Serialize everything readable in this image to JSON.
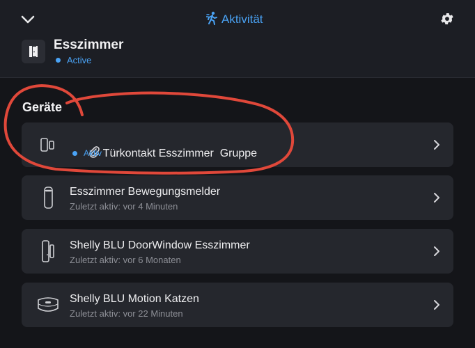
{
  "header": {
    "back_icon": "chevron-down-icon",
    "activity_label": "Aktivität",
    "activity_icon": "walking-person-icon",
    "settings_icon": "gear-icon",
    "room": {
      "name": "Esszimmer",
      "status": "Active",
      "icon": "door-icon"
    }
  },
  "devices": {
    "title": "Geräte",
    "items": [
      {
        "title": "Türkontakt Esszimmer  Gruppe",
        "subtitle": "Aktiv",
        "icon": "door-contact-icon",
        "linked_icon": "paperclip-icon"
      },
      {
        "title": "Esszimmer Bewegungsmelder",
        "subtitle": "Zuletzt aktiv: vor 4 Minuten",
        "icon": "motion-sensor-icon"
      },
      {
        "title": "Shelly BLU DoorWindow Esszimmer",
        "subtitle": "Zuletzt aktiv: vor 6 Monaten",
        "icon": "door-window-sensor-icon"
      },
      {
        "title": "Shelly BLU Motion Katzen",
        "subtitle": "Zuletzt aktiv: vor 22 Minuten",
        "icon": "motion-puck-icon"
      }
    ]
  },
  "colors": {
    "accent": "#4aa3f5",
    "annotation": "#e0483a",
    "background": "#141519",
    "card": "#25272d"
  }
}
